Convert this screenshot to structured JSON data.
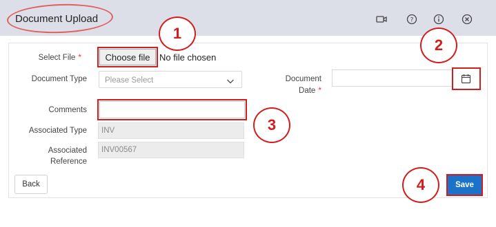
{
  "header": {
    "title": "Document Upload",
    "icons": [
      "video-icon",
      "help-icon",
      "info-icon",
      "close-icon"
    ]
  },
  "form": {
    "select_file_label": "Select File",
    "required_mark": "*",
    "choose_file_label": "Choose file",
    "file_status": "No file chosen",
    "document_type_label": "Document Type",
    "document_type_placeholder": "Please Select",
    "document_date_label_line1": "Document",
    "document_date_label_line2": "Date",
    "comments_label": "Comments",
    "comments_value": "",
    "associated_type_label": "Associated Type",
    "associated_type_value": "INV",
    "associated_reference_label_line1": "Associated",
    "associated_reference_label_line2": "Reference",
    "associated_reference_value": "INV00567"
  },
  "footer": {
    "back_label": "Back",
    "save_label": "Save"
  },
  "annotations": {
    "callout_1": "1",
    "callout_2": "2",
    "callout_3": "3",
    "callout_4": "4"
  },
  "colors": {
    "header_bg": "#dcdfe8",
    "annotation_red": "#d41c1c",
    "save_blue": "#1a72c9",
    "required_red": "#e33333"
  }
}
